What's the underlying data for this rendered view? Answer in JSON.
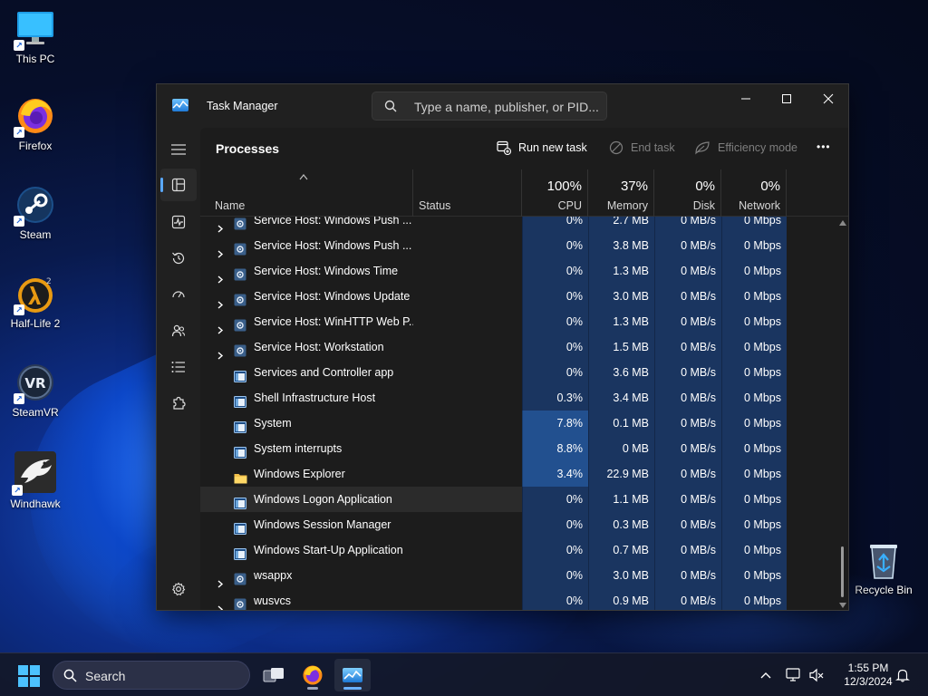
{
  "desktop": {
    "icons": [
      {
        "label": "This PC"
      },
      {
        "label": "Firefox"
      },
      {
        "label": "Steam"
      },
      {
        "label": "Half-Life 2"
      },
      {
        "label": "SteamVR"
      },
      {
        "label": "Windhawk"
      },
      {
        "label": "Recycle Bin"
      }
    ],
    "vr_text": "VR"
  },
  "window": {
    "title": "Task Manager",
    "search_placeholder": "Type a name, publisher, or PID...",
    "page_title": "Processes",
    "commands": {
      "run_new_task": "Run new task",
      "end_task": "End task",
      "efficiency_mode": "Efficiency mode",
      "more": "•••"
    },
    "columns": {
      "name": "Name",
      "status": "Status",
      "cpu_pct": "100%",
      "cpu": "CPU",
      "memory_pct": "37%",
      "memory": "Memory",
      "disk_pct": "0%",
      "disk": "Disk",
      "network_pct": "0%",
      "network": "Network"
    },
    "rows": [
      {
        "name": "Service Host: Windows Push ...",
        "expandable": true,
        "icon": "gear-icon",
        "cpu": "0%",
        "mem": "2.7 MB",
        "disk": "0 MB/s",
        "net": "0 Mbps"
      },
      {
        "name": "Service Host: Windows Push ...",
        "expandable": true,
        "icon": "gear-icon",
        "cpu": "0%",
        "mem": "3.8 MB",
        "disk": "0 MB/s",
        "net": "0 Mbps"
      },
      {
        "name": "Service Host: Windows Time",
        "expandable": true,
        "icon": "gear-icon",
        "cpu": "0%",
        "mem": "1.3 MB",
        "disk": "0 MB/s",
        "net": "0 Mbps"
      },
      {
        "name": "Service Host: Windows Update",
        "expandable": true,
        "icon": "gear-icon",
        "cpu": "0%",
        "mem": "3.0 MB",
        "disk": "0 MB/s",
        "net": "0 Mbps"
      },
      {
        "name": "Service Host: WinHTTP Web P...",
        "expandable": true,
        "icon": "gear-icon",
        "cpu": "0%",
        "mem": "1.3 MB",
        "disk": "0 MB/s",
        "net": "0 Mbps"
      },
      {
        "name": "Service Host: Workstation",
        "expandable": true,
        "icon": "gear-icon",
        "cpu": "0%",
        "mem": "1.5 MB",
        "disk": "0 MB/s",
        "net": "0 Mbps"
      },
      {
        "name": "Services and Controller app",
        "expandable": false,
        "icon": "window-icon",
        "cpu": "0%",
        "mem": "3.6 MB",
        "disk": "0 MB/s",
        "net": "0 Mbps"
      },
      {
        "name": "Shell Infrastructure Host",
        "expandable": false,
        "icon": "window-icon",
        "cpu": "0.3%",
        "mem": "3.4 MB",
        "disk": "0 MB/s",
        "net": "0 Mbps"
      },
      {
        "name": "System",
        "expandable": false,
        "icon": "window-icon",
        "cpu": "7.8%",
        "mem": "0.1 MB",
        "disk": "0 MB/s",
        "net": "0 Mbps"
      },
      {
        "name": "System interrupts",
        "expandable": false,
        "icon": "window-icon",
        "cpu": "8.8%",
        "mem": "0 MB",
        "disk": "0 MB/s",
        "net": "0 Mbps"
      },
      {
        "name": "Windows Explorer",
        "expandable": false,
        "icon": "folder-icon",
        "cpu": "3.4%",
        "mem": "22.9 MB",
        "disk": "0 MB/s",
        "net": "0 Mbps"
      },
      {
        "name": "Windows Logon Application",
        "expandable": false,
        "icon": "window-icon",
        "cpu": "0%",
        "mem": "1.1 MB",
        "disk": "0 MB/s",
        "net": "0 Mbps",
        "hover": true
      },
      {
        "name": "Windows Session Manager",
        "expandable": false,
        "icon": "window-icon",
        "cpu": "0%",
        "mem": "0.3 MB",
        "disk": "0 MB/s",
        "net": "0 Mbps"
      },
      {
        "name": "Windows Start-Up Application",
        "expandable": false,
        "icon": "window-icon",
        "cpu": "0%",
        "mem": "0.7 MB",
        "disk": "0 MB/s",
        "net": "0 Mbps"
      },
      {
        "name": "wsappx",
        "expandable": true,
        "icon": "gear-icon",
        "cpu": "0%",
        "mem": "3.0 MB",
        "disk": "0 MB/s",
        "net": "0 Mbps"
      },
      {
        "name": "wusvcs",
        "expandable": true,
        "icon": "gear-icon",
        "cpu": "0%",
        "mem": "0.9 MB",
        "disk": "0 MB/s",
        "net": "0 Mbps"
      }
    ]
  },
  "taskbar": {
    "search_label": "Search",
    "time": "1:55 PM",
    "date": "12/3/2024"
  },
  "colors": {
    "accent": "#5aa9ff",
    "cpu_heat_low": "#1a3560",
    "cpu_heat_high": "#22508f"
  }
}
